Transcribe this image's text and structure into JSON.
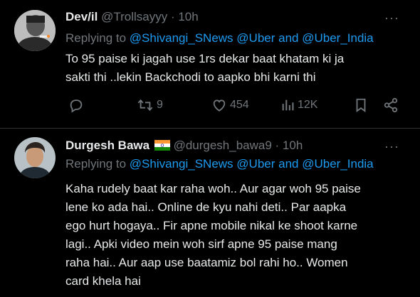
{
  "tweets": [
    {
      "display_name": "Dev/il",
      "handle": "@Trollsayyy",
      "time": "· 10h",
      "more": "···",
      "replying_prefix": "Replying to ",
      "mention1": "@Shivangi_SNews",
      "mention2": "@Uber",
      "and": " and ",
      "mention3": "@Uber_India",
      "lines": [
        "To 95 paise ki jagah use 1rs dekar baat khatam ki ja",
        "sakti thi ..lekin Backchodi to aapko bhi karni thi"
      ],
      "actions": {
        "replies": "",
        "retweets": "9",
        "likes": "454",
        "views": "12K"
      }
    },
    {
      "display_name": "Durgesh Bawa",
      "flag": "india-flag",
      "handle": "@durgesh_bawa9",
      "time": "· 10h",
      "more": "···",
      "replying_prefix": "Replying to ",
      "mention1": "@Shivangi_SNews",
      "mention2": "@Uber",
      "and": " and ",
      "mention3": "@Uber_India",
      "lines": [
        "Kaha rudely baat kar raha woh.. Aur agar woh 95 paise",
        "lene ko ada hai.. Online de kyu nahi deti.. Par aapka",
        "ego hurt hogaya.. Fir apne mobile nikal ke shoot karne",
        "lagi.. Apki video mein woh sirf apne 95 paise mang",
        "raha hai.. Aur aap use baatamiz bol rahi ho.. Women",
        "card khela hai"
      ]
    }
  ]
}
